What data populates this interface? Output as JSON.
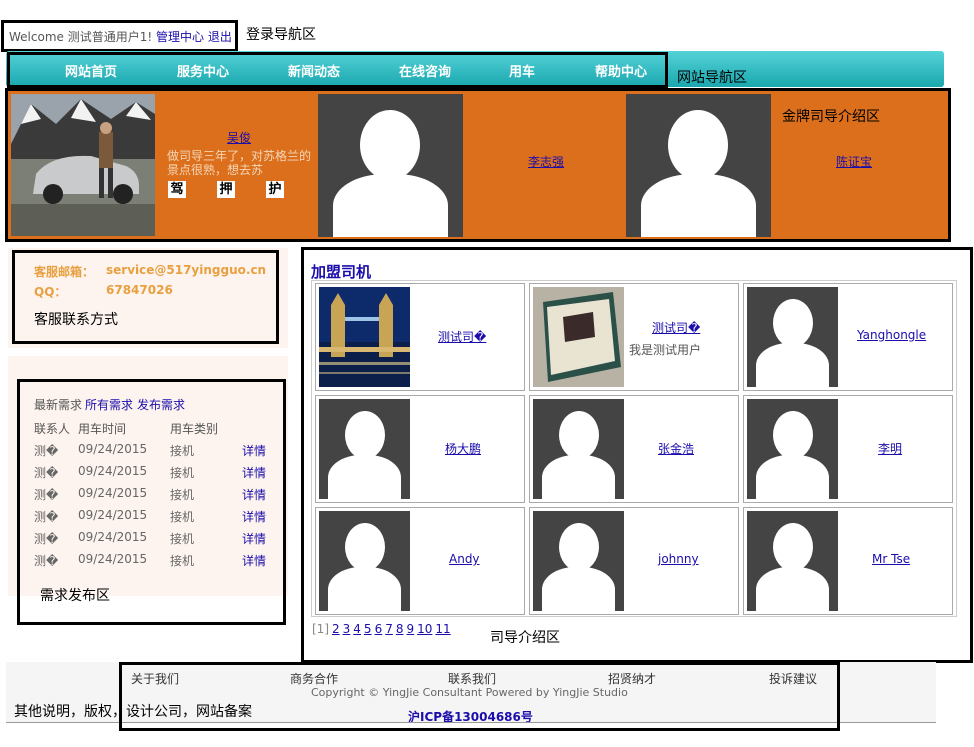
{
  "login": {
    "welcome": "Welcome 测试普通用户1!",
    "manage": "管理中心",
    "logout": "退出",
    "annotation": "登录导航区"
  },
  "nav": {
    "items": [
      "网站首页",
      "服务中心",
      "新闻动态",
      "在线咨询",
      "用车",
      "帮助中心"
    ],
    "annotation": "网站导航区"
  },
  "gold": {
    "annotation": "金牌司导介绍区",
    "drivers": [
      {
        "name": "吴俊",
        "desc": "做司导三年了，对苏格兰的景点很熟，想去苏",
        "skills": [
          "驾",
          "押",
          "护"
        ]
      },
      {
        "name": "李志强"
      },
      {
        "name": "陈证宝"
      }
    ]
  },
  "service": {
    "email_label": "客服邮箱：",
    "email": "service@517yingguo.cn",
    "qq_label": "QQ：",
    "qq": "67847026",
    "annotation": "客服联系方式"
  },
  "demand": {
    "links": [
      "最新需求",
      "所有需求",
      "发布需求"
    ],
    "headers": [
      "联系人",
      "用车时间",
      "用车类别"
    ],
    "rows": [
      {
        "contact": "测�",
        "date": "09/24/2015",
        "type": "接机",
        "detail": "详情"
      },
      {
        "contact": "测�",
        "date": "09/24/2015",
        "type": "接机",
        "detail": "详情"
      },
      {
        "contact": "测�",
        "date": "09/24/2015",
        "type": "接机",
        "detail": "详情"
      },
      {
        "contact": "测�",
        "date": "09/24/2015",
        "type": "接机",
        "detail": "详情"
      },
      {
        "contact": "测�",
        "date": "09/24/2015",
        "type": "接机",
        "detail": "详情"
      },
      {
        "contact": "测�",
        "date": "09/24/2015",
        "type": "接机",
        "detail": "详情"
      }
    ],
    "annotation": "需求发布区"
  },
  "drivers": {
    "title": "加盟司机",
    "cards": [
      {
        "name": "测试司�",
        "desc": "",
        "photo": "bridge-photo"
      },
      {
        "name": "测试司�",
        "desc": "我是测试用户",
        "photo": "book-photo"
      },
      {
        "name": "Yanghongle",
        "desc": "",
        "photo": "avatar-placeholder"
      },
      {
        "name": "杨大鹏",
        "desc": "",
        "photo": "avatar-placeholder"
      },
      {
        "name": "张金浩",
        "desc": "",
        "photo": "avatar-placeholder"
      },
      {
        "name": "李明",
        "desc": "",
        "photo": "avatar-placeholder"
      },
      {
        "name": "Andy",
        "desc": "",
        "photo": "avatar-placeholder"
      },
      {
        "name": "johnny",
        "desc": "",
        "photo": "avatar-placeholder"
      },
      {
        "name": "Mr Tse",
        "desc": "",
        "photo": "avatar-placeholder"
      }
    ],
    "pager_current": "[1]",
    "pages": [
      "2",
      "3",
      "4",
      "5",
      "6",
      "7",
      "8",
      "9",
      "10",
      "11"
    ],
    "annotation": "司导介绍区"
  },
  "footer": {
    "links": [
      "关于我们",
      "商务合作",
      "联系我们",
      "招贤纳才",
      "投诉建议"
    ],
    "copyright": "Copyright © YingJie Consultant Powered by YingJie Studio",
    "icp": "沪ICP备13004686号",
    "annotation": "其他说明，版权，设计公司，网站备案"
  },
  "colors": {
    "nav": "#1aa7ae",
    "gold_bg": "#dc6f1c",
    "link": "#1a0dab",
    "service_text": "#e8a040"
  }
}
